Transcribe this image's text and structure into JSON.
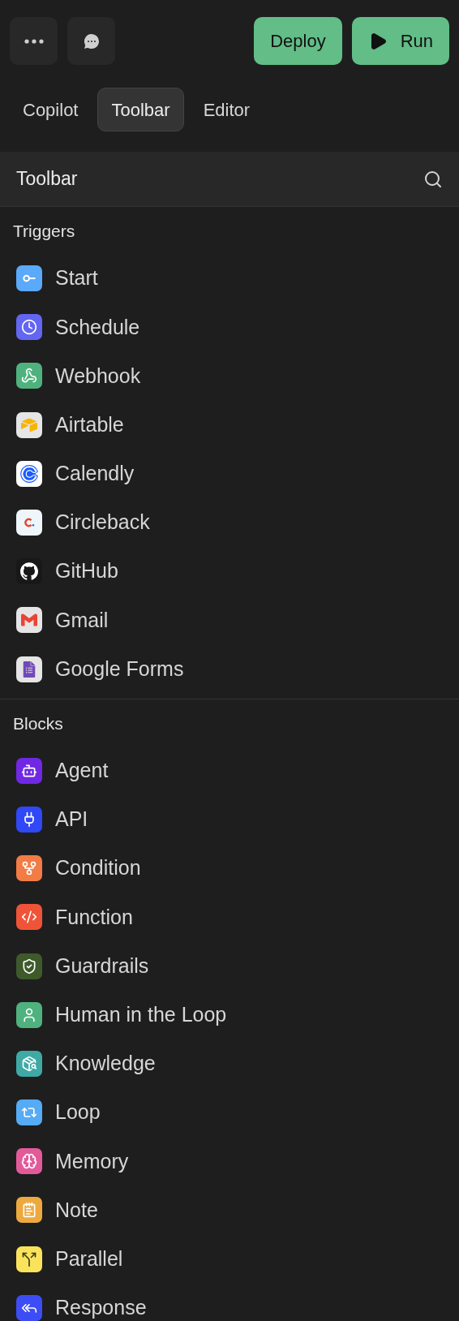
{
  "top_bar": {
    "buttons": [
      {
        "label": "Deploy"
      },
      {
        "label": "Run"
      }
    ]
  },
  "tabs": [
    {
      "label": "Copilot",
      "selected": false
    },
    {
      "label": "Toolbar",
      "selected": true
    },
    {
      "label": "Editor",
      "selected": false
    }
  ],
  "panel": {
    "title": "Toolbar"
  },
  "sections": [
    {
      "title": "Triggers",
      "items": [
        {
          "label": "Start",
          "color": "#5aa9fa"
        },
        {
          "label": "Schedule",
          "color": "#6366f1"
        },
        {
          "label": "Webhook",
          "color": "#4fb27e"
        },
        {
          "label": "Airtable",
          "color": "#e5e5e5"
        },
        {
          "label": "Calendly",
          "color": "#ffffff"
        },
        {
          "label": "Circleback",
          "color": "#eef6fc"
        },
        {
          "label": "GitHub",
          "color": "#181818"
        },
        {
          "label": "Gmail",
          "color": "#e5e5e5"
        },
        {
          "label": "Google Forms",
          "color": "#e5e5e5"
        }
      ]
    },
    {
      "title": "Blocks",
      "items": [
        {
          "label": "Agent",
          "color": "#7028e4"
        },
        {
          "label": "API",
          "color": "#3048f5"
        },
        {
          "label": "Condition",
          "color": "#f27c45"
        },
        {
          "label": "Function",
          "color": "#ef5438"
        },
        {
          "label": "Guardrails",
          "color": "#3e5a2b"
        },
        {
          "label": "Human in the Loop",
          "color": "#4fb27e"
        },
        {
          "label": "Knowledge",
          "color": "#3fa9a6"
        },
        {
          "label": "Loop",
          "color": "#55abf5"
        },
        {
          "label": "Memory",
          "color": "#e35a9a"
        },
        {
          "label": "Note",
          "color": "#eda93e"
        },
        {
          "label": "Parallel",
          "color": "#fae35c"
        },
        {
          "label": "Response",
          "color": "#3d4df5"
        }
      ]
    }
  ]
}
